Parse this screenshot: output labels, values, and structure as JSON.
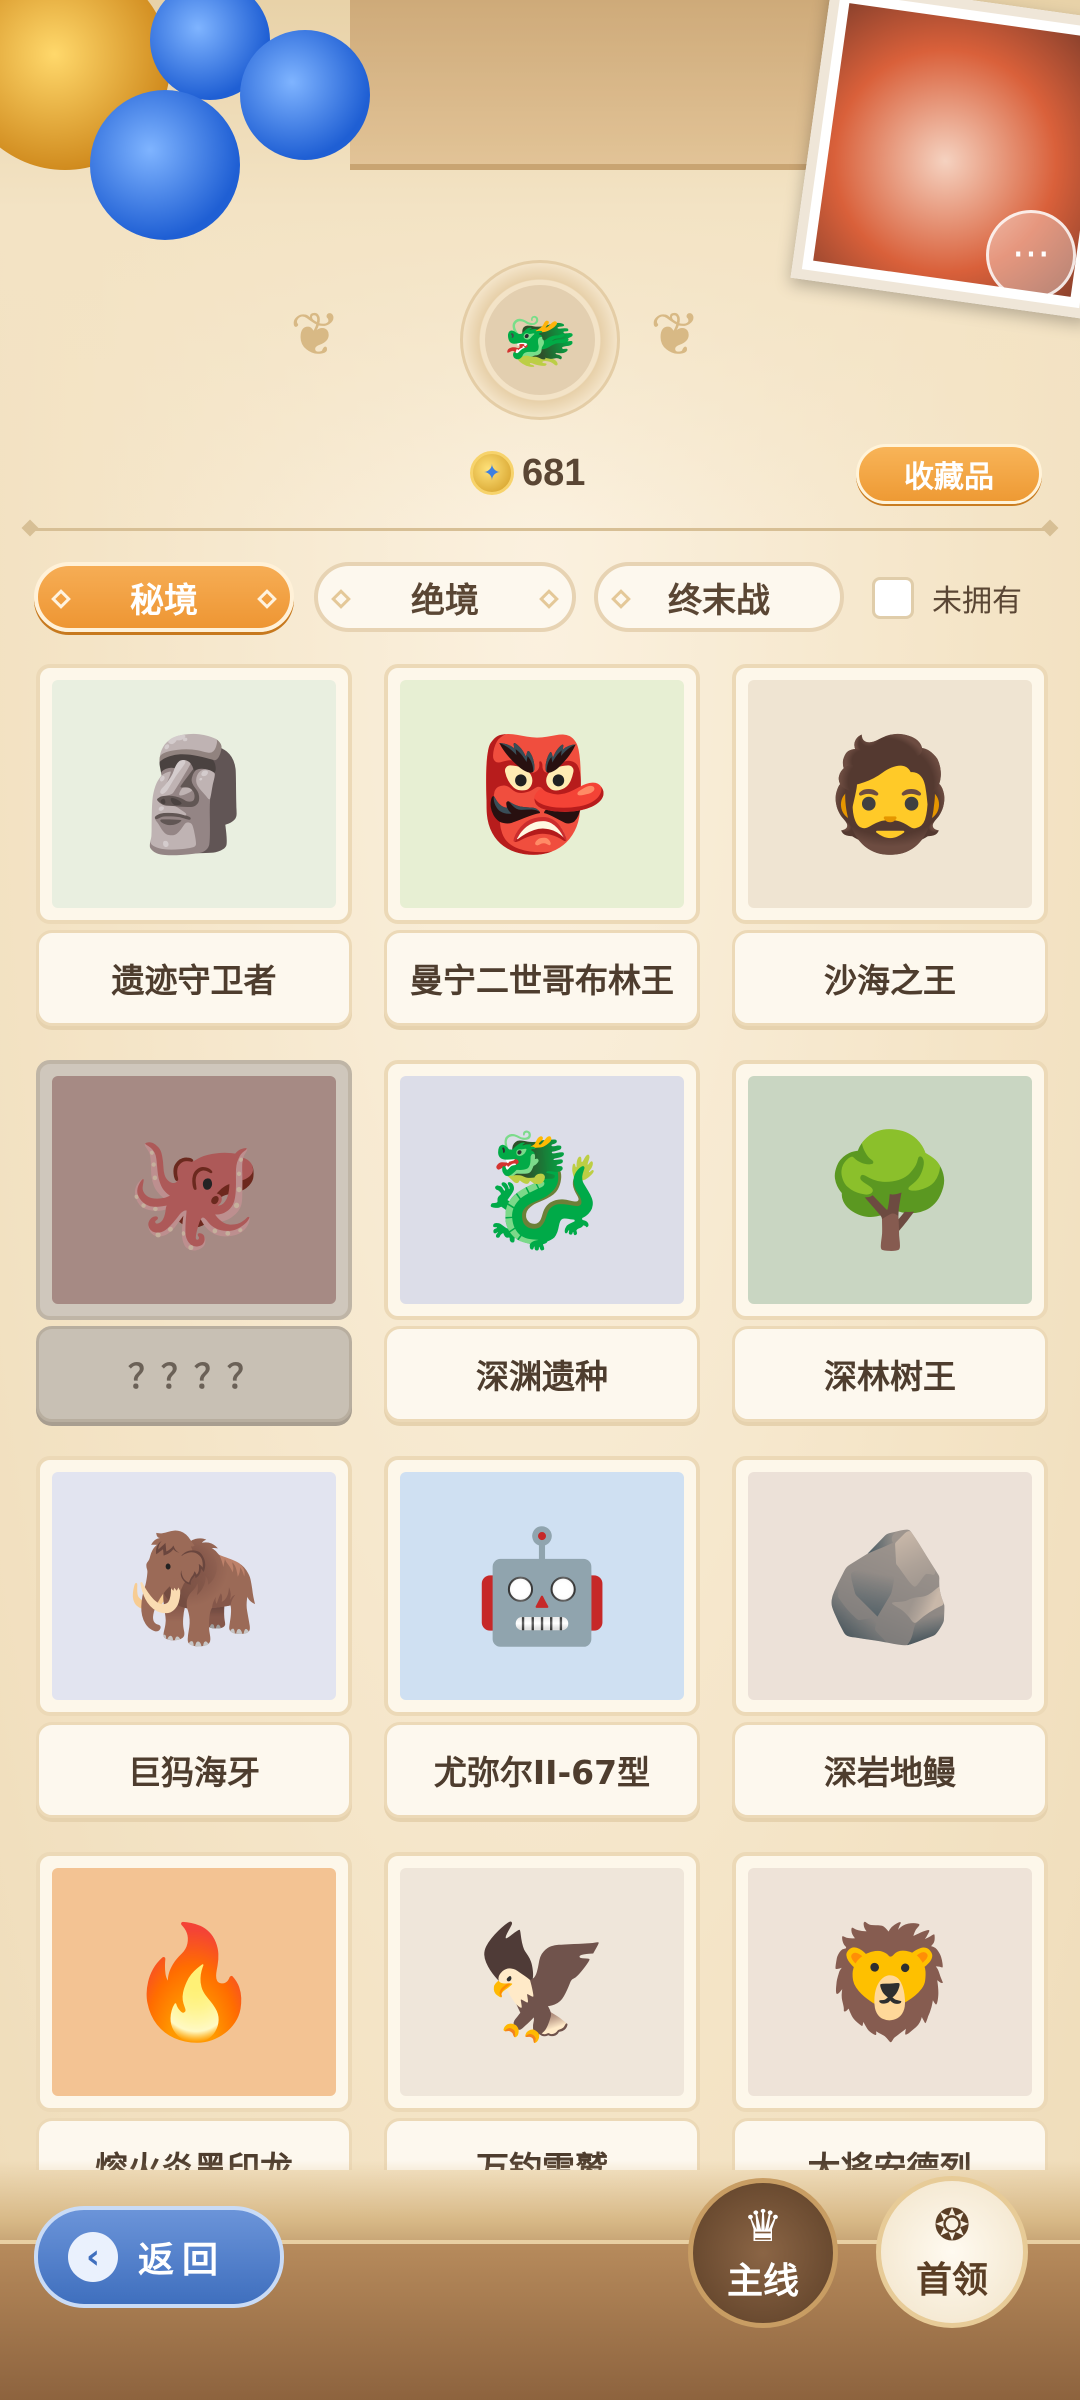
{
  "header": {
    "currency_value": "681",
    "collect_label": "收藏品",
    "chat_icon": "chat-bubble-icon",
    "emblem_icon": "dragon-icon"
  },
  "tabs": [
    {
      "label": "秘境",
      "active": true
    },
    {
      "label": "绝境",
      "active": false
    },
    {
      "label": "终末战",
      "active": false
    }
  ],
  "filter": {
    "label": "未拥有",
    "checked": false
  },
  "bosses": [
    {
      "name": "遗迹守卫者",
      "glyph": "🗿",
      "bg": "#e9efe0",
      "locked": false
    },
    {
      "name": "曼宁二世哥布林王",
      "glyph": "👺",
      "bg": "#e7efd3",
      "locked": false
    },
    {
      "name": "沙海之王",
      "glyph": "🧔",
      "bg": "#efe4d2",
      "locked": false
    },
    {
      "name": "？？？？",
      "glyph": "🐙",
      "bg": "#d9a59a",
      "locked": true
    },
    {
      "name": "深渊遗种",
      "glyph": "🐉",
      "bg": "#dcdde8",
      "locked": false
    },
    {
      "name": "深林树王",
      "glyph": "🌳",
      "bg": "#c9d6c2",
      "locked": false
    },
    {
      "name": "巨犸海牙",
      "glyph": "🦣",
      "bg": "#e2e4f0",
      "locked": false
    },
    {
      "name": "尤弥尔II-67型",
      "glyph": "🤖",
      "bg": "#cfe0f2",
      "locked": false
    },
    {
      "name": "深岩地鳗",
      "glyph": "🪨",
      "bg": "#ece1d8",
      "locked": false
    },
    {
      "name": "熔火炎黑印龙",
      "glyph": "🔥",
      "bg": "#f3c393",
      "locked": false
    },
    {
      "name": "万钧雷鹫",
      "glyph": "🦅",
      "bg": "#efe6da",
      "locked": false
    },
    {
      "name": "大将安德烈",
      "glyph": "🦁",
      "bg": "#eee3d8",
      "locked": false
    }
  ],
  "bottom": {
    "back_label": "返回",
    "nav_main_label": "主线",
    "nav_boss_label": "首领"
  }
}
